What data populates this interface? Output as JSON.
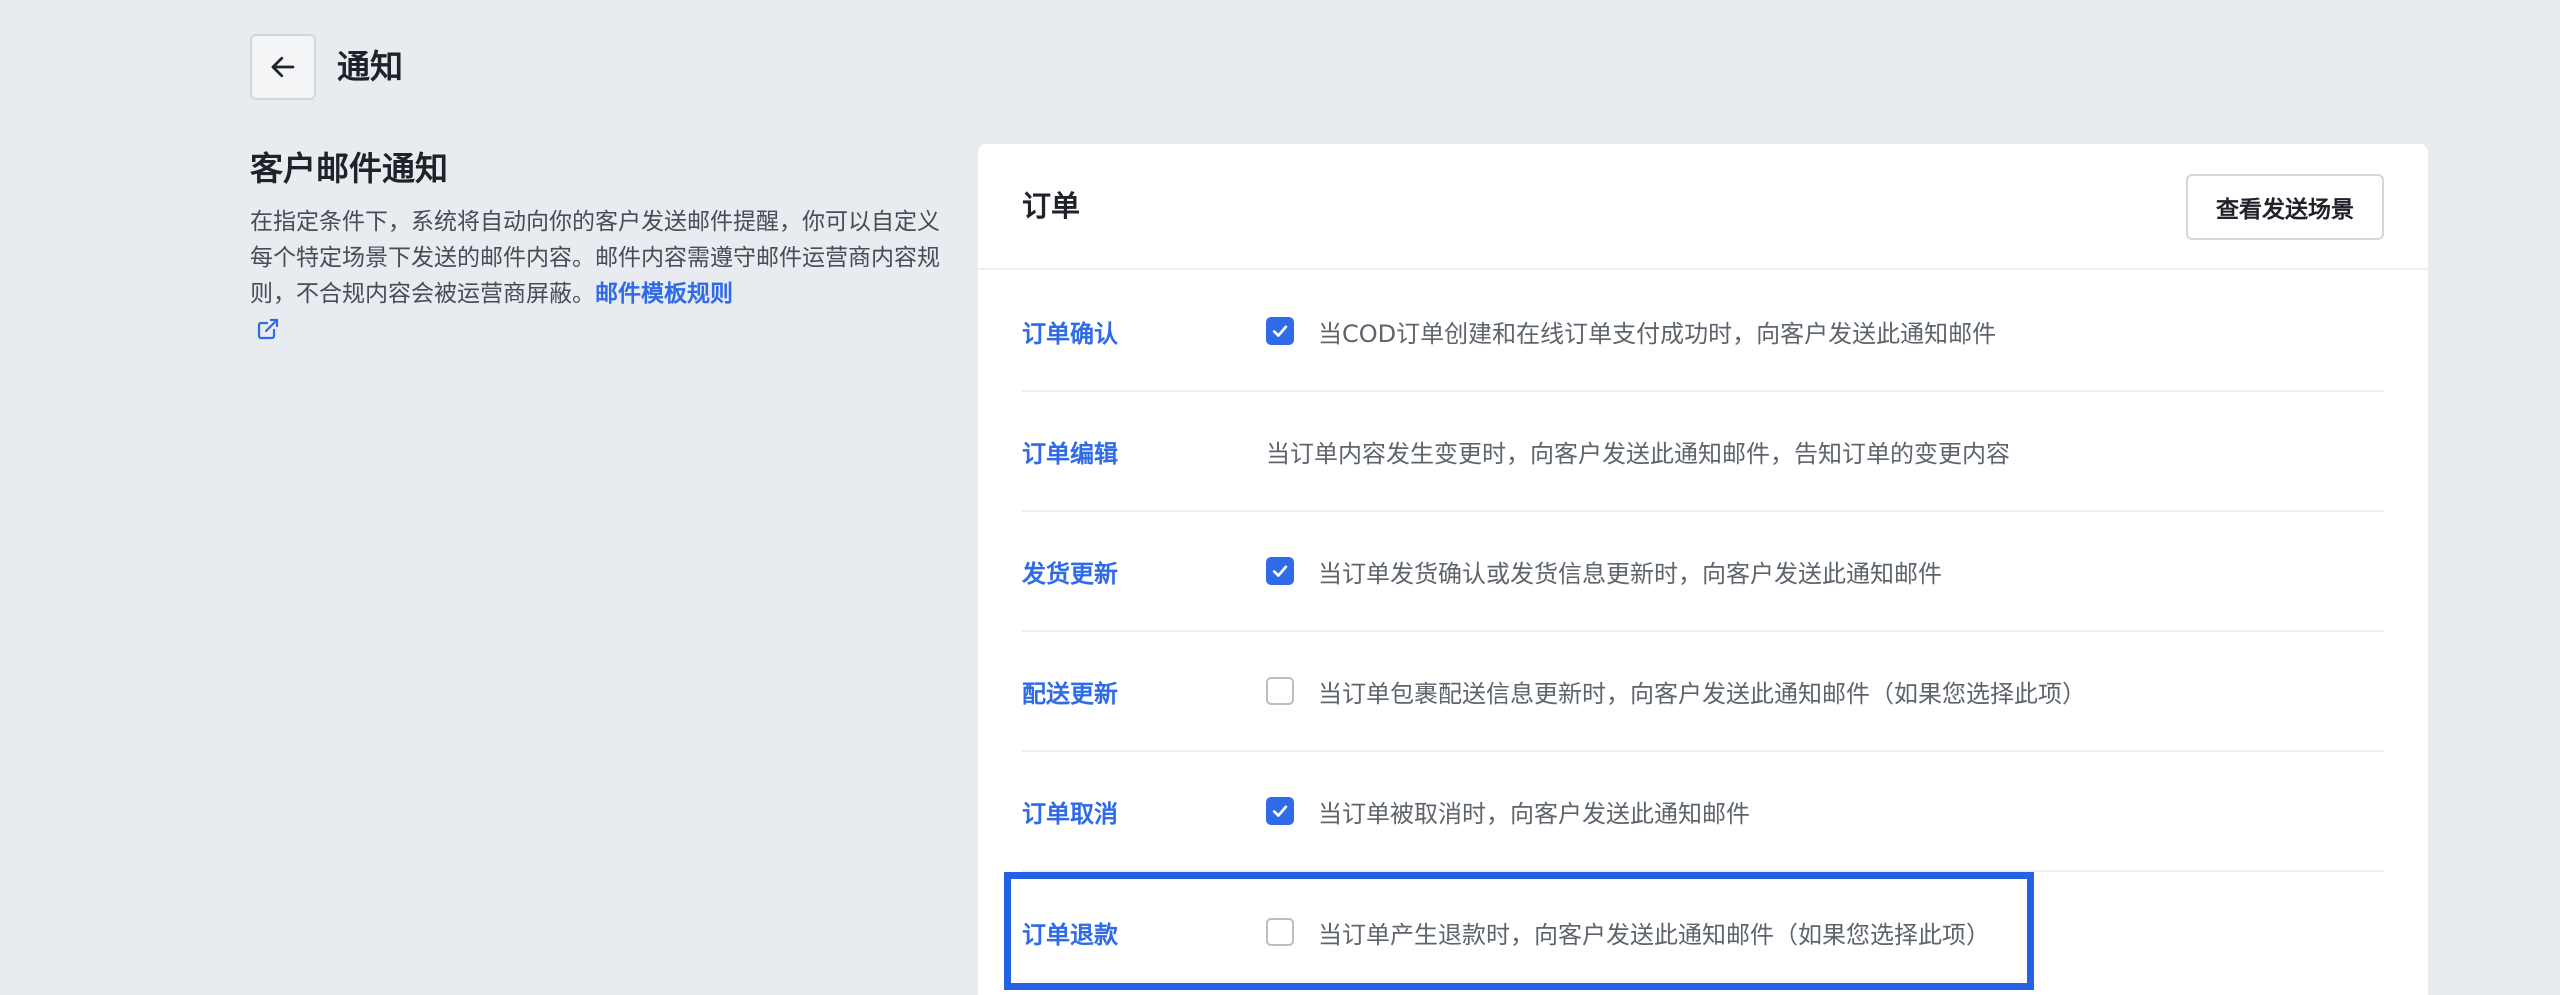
{
  "header": {
    "title": "通知"
  },
  "side": {
    "heading": "客户邮件通知",
    "description": "在指定条件下，系统将自动向你的客户发送邮件提醒，你可以自定义每个特定场景下发送的邮件内容。邮件内容需遵守邮件运营商内容规则，不合规内容会被运营商屏蔽。",
    "link_label": "邮件模板规则"
  },
  "card": {
    "title": "订单",
    "scene_button": "查看发送场景",
    "rows": [
      {
        "label": "订单确认",
        "checkbox": "checked",
        "text": "当COD订单创建和在线订单支付成功时，向客户发送此通知邮件"
      },
      {
        "label": "订单编辑",
        "checkbox": "none",
        "text": "当订单内容发生变更时，向客户发送此通知邮件，告知订单的变更内容"
      },
      {
        "label": "发货更新",
        "checkbox": "checked",
        "text": "当订单发货确认或发货信息更新时，向客户发送此通知邮件"
      },
      {
        "label": "配送更新",
        "checkbox": "unchecked",
        "text": "当订单包裹配送信息更新时，向客户发送此通知邮件（如果您选择此项）"
      },
      {
        "label": "订单取消",
        "checkbox": "checked",
        "text": "当订单被取消时，向客户发送此通知邮件"
      },
      {
        "label": "订单退款",
        "checkbox": "unchecked",
        "text": "当订单产生退款时，向客户发送此通知邮件（如果您选择此项）"
      }
    ]
  },
  "colors": {
    "accent": "#2f6be9",
    "highlight": "#2561e4",
    "background": "#e8ebef"
  },
  "icons": {
    "back": "arrow-left-icon",
    "external": "external-link-icon",
    "check": "check-icon"
  }
}
